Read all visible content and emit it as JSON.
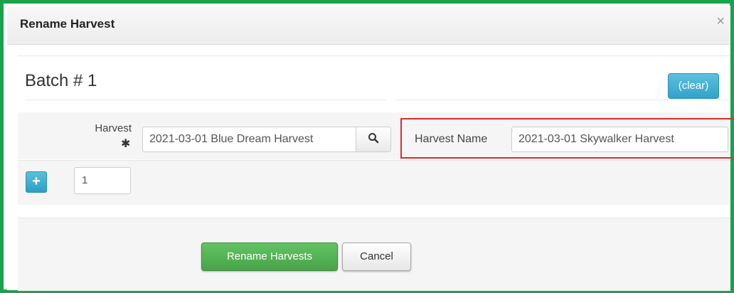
{
  "dialog": {
    "title": "Rename Harvest",
    "close_symbol": "×"
  },
  "batch": {
    "title": "Batch # 1",
    "clear_label": "(clear)"
  },
  "fields": {
    "harvest_label": "Harvest",
    "required_marker": "✱",
    "harvest_value": "2021-03-01 Blue Dream Harvest",
    "harvest_name_label": "Harvest Name",
    "harvest_name_value": "2021-03-01 Skywalker Harvest"
  },
  "rows": {
    "add_symbol": "+",
    "count_value": "1"
  },
  "footer": {
    "rename_label": "Rename Harvests",
    "cancel_label": "Cancel"
  },
  "colors": {
    "frame_border": "#1aa34a",
    "highlight_border": "#e12a2a",
    "primary_button": "#5cb85c",
    "info_button": "#5bc0de"
  },
  "icons": {
    "search": "search-icon",
    "close": "close-icon",
    "plus": "plus-icon",
    "required": "asterisk-icon"
  }
}
